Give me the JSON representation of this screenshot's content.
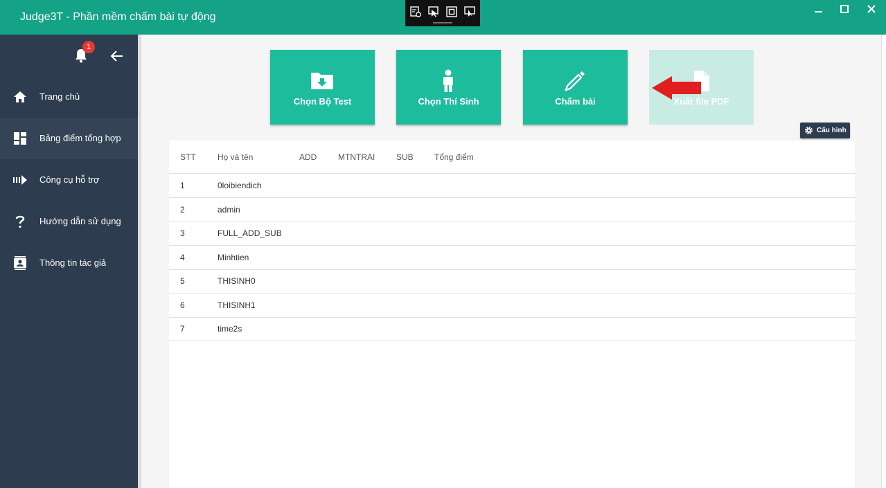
{
  "window": {
    "title": "Judge3T - Phần mềm chấm bài tự động",
    "minimize_icon": "minimize-icon",
    "maximize_icon": "maximize-icon",
    "close_icon": "close-icon"
  },
  "debug_toolbar": {
    "icons": [
      "select-element-icon",
      "cursor-select-icon",
      "layout-bounds-icon",
      "track-focus-icon"
    ]
  },
  "sidebar": {
    "notification_count": "1",
    "items": [
      {
        "label": "Trang chủ",
        "icon": "home-icon"
      },
      {
        "label": "Bảng điểm tổng hợp",
        "icon": "dashboard-icon"
      },
      {
        "label": "Công cụ hỗ trợ",
        "icon": "tools-icon"
      },
      {
        "label": "Hướng dẫn sử dụng",
        "icon": "help-icon"
      },
      {
        "label": "Thông tin tác giả",
        "icon": "contact-icon"
      }
    ],
    "active_index": 1
  },
  "actions": [
    {
      "label": "Chọn Bộ Test",
      "icon": "folder-download-icon",
      "enabled": true
    },
    {
      "label": "Chọn Thí Sinh",
      "icon": "person-icon",
      "enabled": true
    },
    {
      "label": "Chấm bài",
      "icon": "pencil-icon",
      "enabled": true
    },
    {
      "label": "Xuất file PDF",
      "icon": "pdf-file-icon",
      "enabled": false
    }
  ],
  "config_button": {
    "label": "Cấu hình",
    "icon": "gear-icon"
  },
  "table": {
    "columns": [
      "STT",
      "Họ và tên",
      "ADD",
      "MTNTRAI",
      "SUB",
      "Tổng điểm"
    ],
    "rows": [
      {
        "stt": "1",
        "name": "0loibiendich"
      },
      {
        "stt": "2",
        "name": "admin"
      },
      {
        "stt": "3",
        "name": "FULL_ADD_SUB"
      },
      {
        "stt": "4",
        "name": "Minhtien"
      },
      {
        "stt": "5",
        "name": "THISINH0"
      },
      {
        "stt": "6",
        "name": "THISINH1"
      },
      {
        "stt": "7",
        "name": "time2s"
      }
    ]
  },
  "colors": {
    "title_bar": "#14a386",
    "sidebar": "#2e3c4f",
    "accent": "#1dbc9c",
    "annotation_arrow": "#e02020"
  }
}
